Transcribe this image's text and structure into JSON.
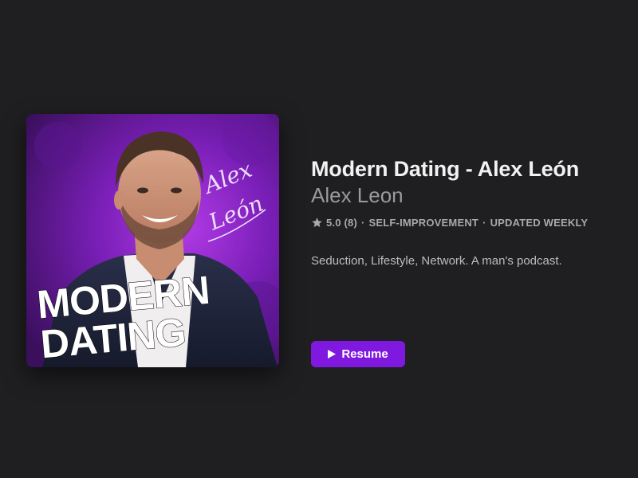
{
  "podcast": {
    "title": "Modern Dating - Alex León",
    "author": "Alex Leon",
    "rating": "5.0",
    "rating_count": "(8)",
    "category": "SELF-IMPROVEMENT",
    "frequency": "UPDATED WEEKLY",
    "separator": "·",
    "description": "Seduction, Lifestyle, Network. A man's podcast."
  },
  "artwork": {
    "headline_line1": "MODERN",
    "headline_line2": "DATING",
    "signature_line1": "Alex",
    "signature_line2": "León"
  },
  "actions": {
    "resume_label": "Resume"
  },
  "colors": {
    "background": "#1f1e20",
    "accent": "#8019e0",
    "artwork_purple": "#7a1fb8"
  }
}
